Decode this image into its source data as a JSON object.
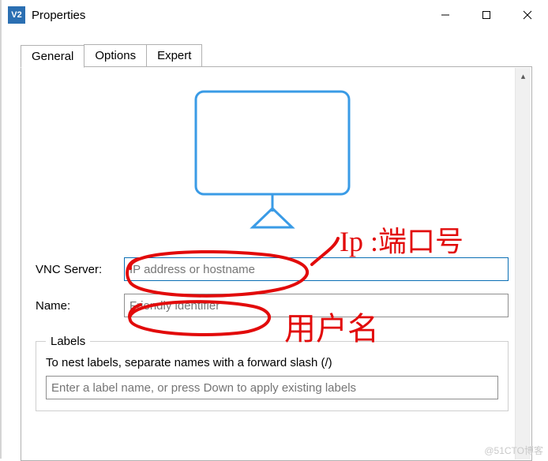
{
  "window": {
    "title": "Properties",
    "app_icon_text": "V2"
  },
  "tabs": {
    "general": "General",
    "options": "Options",
    "expert": "Expert"
  },
  "form": {
    "vnc_server_label": "VNC Server:",
    "vnc_server_placeholder": "IP address or hostname",
    "name_label": "Name:",
    "name_placeholder": "Friendly identifier"
  },
  "labels_section": {
    "legend": "Labels",
    "help": "To nest labels, separate names with a forward slash (/)",
    "input_placeholder": "Enter a label name, or press Down to apply existing labels"
  },
  "annotations": {
    "ip_port": "Ip :端口号",
    "username": "用户名"
  },
  "watermark": "@51CTO博客"
}
